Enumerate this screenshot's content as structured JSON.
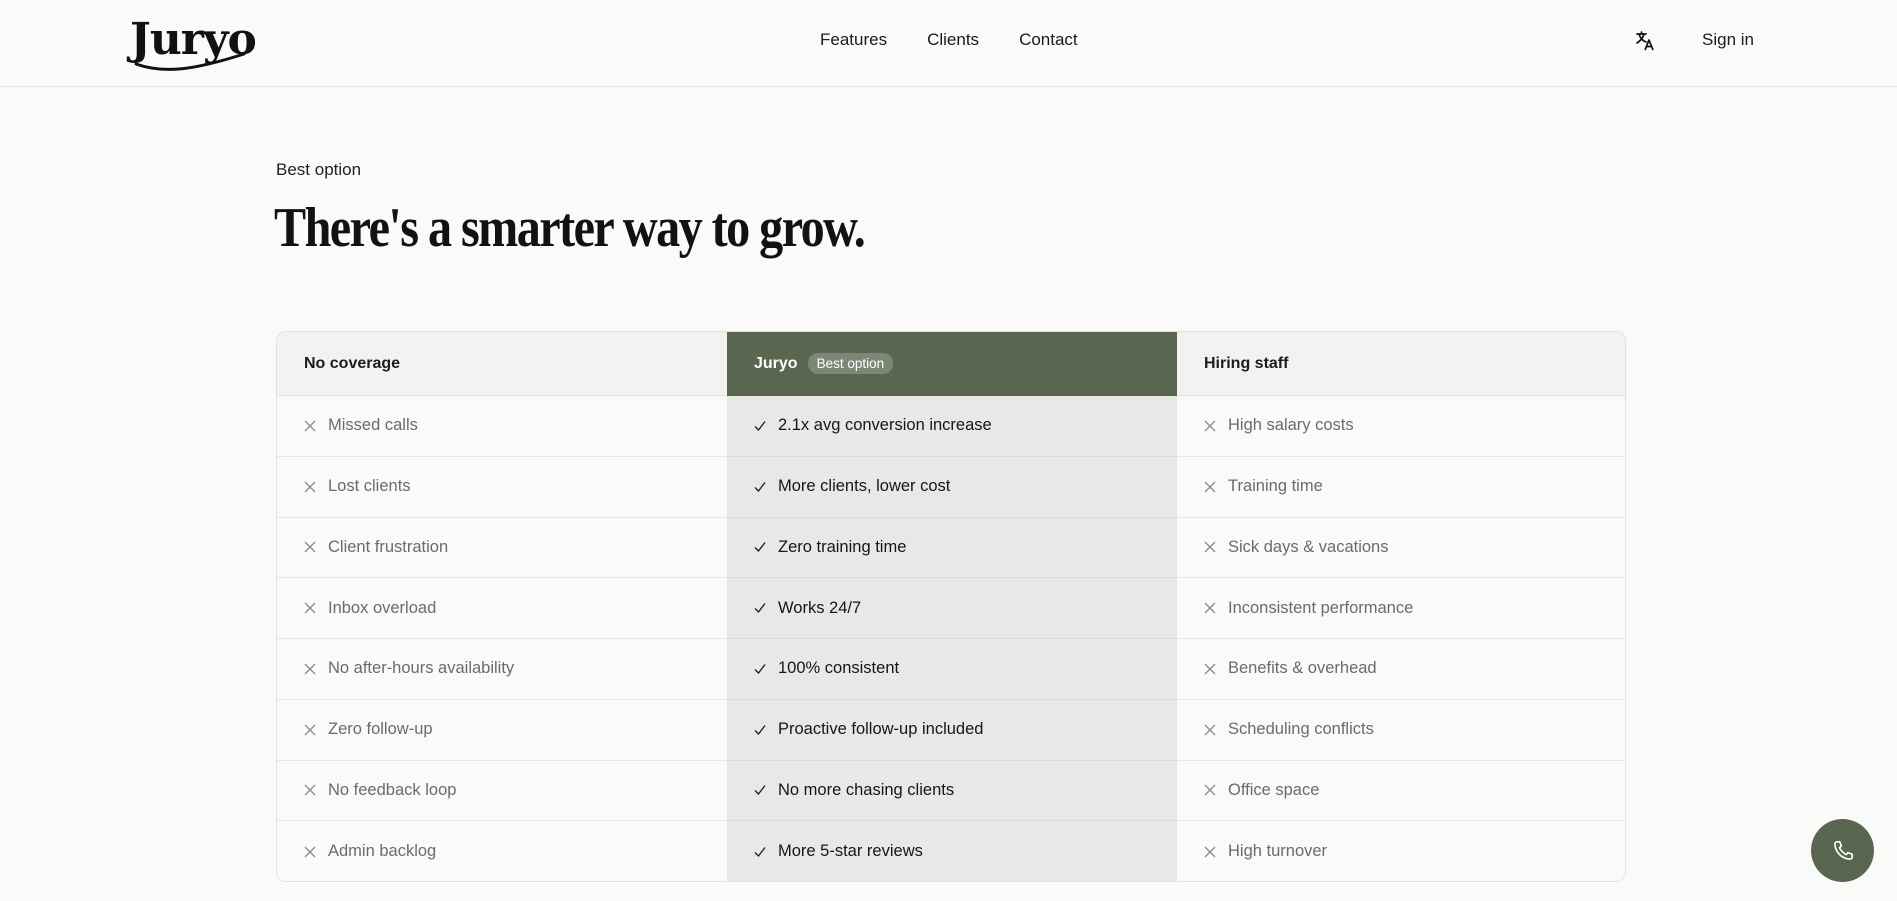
{
  "brand": {
    "name": "Juryo"
  },
  "nav": {
    "items": [
      {
        "label": "Features"
      },
      {
        "label": "Clients"
      },
      {
        "label": "Contact"
      }
    ],
    "signin_label": "Sign in"
  },
  "section": {
    "eyebrow": "Best option",
    "title": "There's a smarter way to grow."
  },
  "comparison": {
    "columns": [
      {
        "header": "No coverage",
        "mark": "x-icon",
        "rows": [
          "Missed calls",
          "Lost clients",
          "Client frustration",
          "Inbox overload",
          "No after-hours availability",
          "Zero follow-up",
          "No feedback loop",
          "Admin backlog"
        ]
      },
      {
        "header": "Juryo",
        "badge": "Best option",
        "mark": "check-icon",
        "rows": [
          "2.1x avg conversion increase",
          "More clients, lower cost",
          "Zero training time",
          "Works 24/7",
          "100% consistent",
          "Proactive follow-up included",
          "No more chasing clients",
          "More 5-star reviews"
        ]
      },
      {
        "header": "Hiring staff",
        "mark": "x-icon",
        "rows": [
          "High salary costs",
          "Training time",
          "Sick days & vacations",
          "Inconsistent performance",
          "Benefits & overhead",
          "Scheduling conflicts",
          "Office space",
          "High turnover"
        ]
      }
    ]
  },
  "colors": {
    "accent": "#596650",
    "highlight_column_bg": "#e8e8e6",
    "page_bg": "#fafaf9"
  },
  "icons": {
    "language": "translate-icon",
    "call": "phone-icon"
  }
}
